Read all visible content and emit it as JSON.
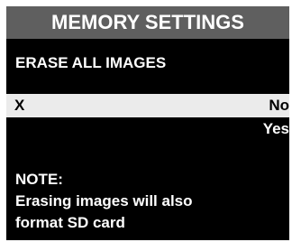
{
  "title": "MEMORY SETTINGS",
  "section_heading": "ERASE ALL IMAGES",
  "options": [
    {
      "marker": "X",
      "label": "No",
      "selected": true
    },
    {
      "marker": "",
      "label": "Yes",
      "selected": false
    }
  ],
  "note": {
    "label": "NOTE:",
    "lines": [
      "Erasing images will also",
      "format SD card"
    ]
  },
  "colors": {
    "background": "#000000",
    "title_bar": "#5f5f5f",
    "selected_row": "#ebebeb",
    "text": "#ffffff"
  }
}
